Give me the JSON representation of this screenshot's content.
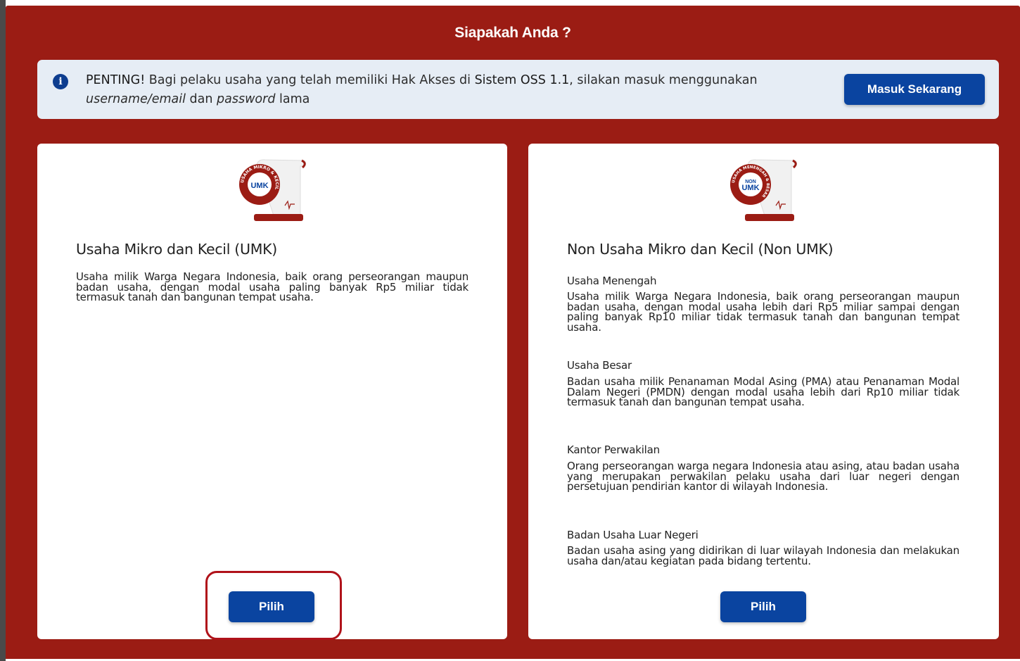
{
  "title": "Siapakah Anda ?",
  "notice": {
    "icon": "info-icon",
    "bold_prefix": "PENTING!",
    "text_part1": " Bagi pelaku usaha yang telah memiliki Hak Akses di ",
    "system_name": "Sistem OSS 1.1",
    "text_part2": ", silakan masuk menggunakan ",
    "username_label": "username/email",
    "text_part3": " dan ",
    "password_label": "password",
    "text_part4": " lama",
    "button_label": "Masuk Sekarang"
  },
  "umk": {
    "logo_text": "UMK",
    "logo_ring_text": "USAHA MIKRO & KECIL",
    "title": "Usaha Mikro dan Kecil (UMK)",
    "description": "Usaha milik Warga Negara Indonesia, baik orang perseorangan maupun badan usaha, dengan modal usaha paling banyak Rp5 miliar tidak termasuk tanah dan bangunan tempat usaha.",
    "button_label": "Pilih"
  },
  "non_umk": {
    "logo_text_top": "NON",
    "logo_text_bottom": "UMK",
    "logo_ring_text": "USAHA MENENGAH & BESAR",
    "title": "Non Usaha Mikro dan Kecil (Non UMK)",
    "sections": [
      {
        "heading": "Usaha Menengah",
        "text": "Usaha milik Warga Negara Indonesia, baik orang perseorangan maupun badan usaha, dengan modal usaha lebih dari Rp5 miliar sampai dengan paling banyak Rp10 miliar tidak termasuk tanah dan bangunan tempat usaha."
      },
      {
        "heading": "Usaha Besar",
        "text": "Badan usaha milik Penanaman Modal Asing (PMA) atau Penanaman Modal Dalam Negeri (PMDN) dengan modal usaha lebih dari Rp10 miliar tidak termasuk tanah dan bangunan tempat usaha."
      },
      {
        "heading": "Kantor Perwakilan",
        "text": "Orang perseorangan warga negara Indonesia atau asing, atau badan usaha yang merupakan perwakilan pelaku usaha dari luar negeri dengan persetujuan pendirian kantor di wilayah Indonesia."
      },
      {
        "heading": "Badan Usaha Luar Negeri",
        "text": "Badan usaha asing yang didirikan di luar wilayah Indonesia dan melakukan usaha dan/atau kegiatan pada bidang tertentu."
      }
    ],
    "button_label": "Pilih"
  },
  "colors": {
    "background": "#9b1c14",
    "primary_button": "#0a44a0",
    "notice_bg": "#e6edf5",
    "highlight": "#b0121a"
  }
}
